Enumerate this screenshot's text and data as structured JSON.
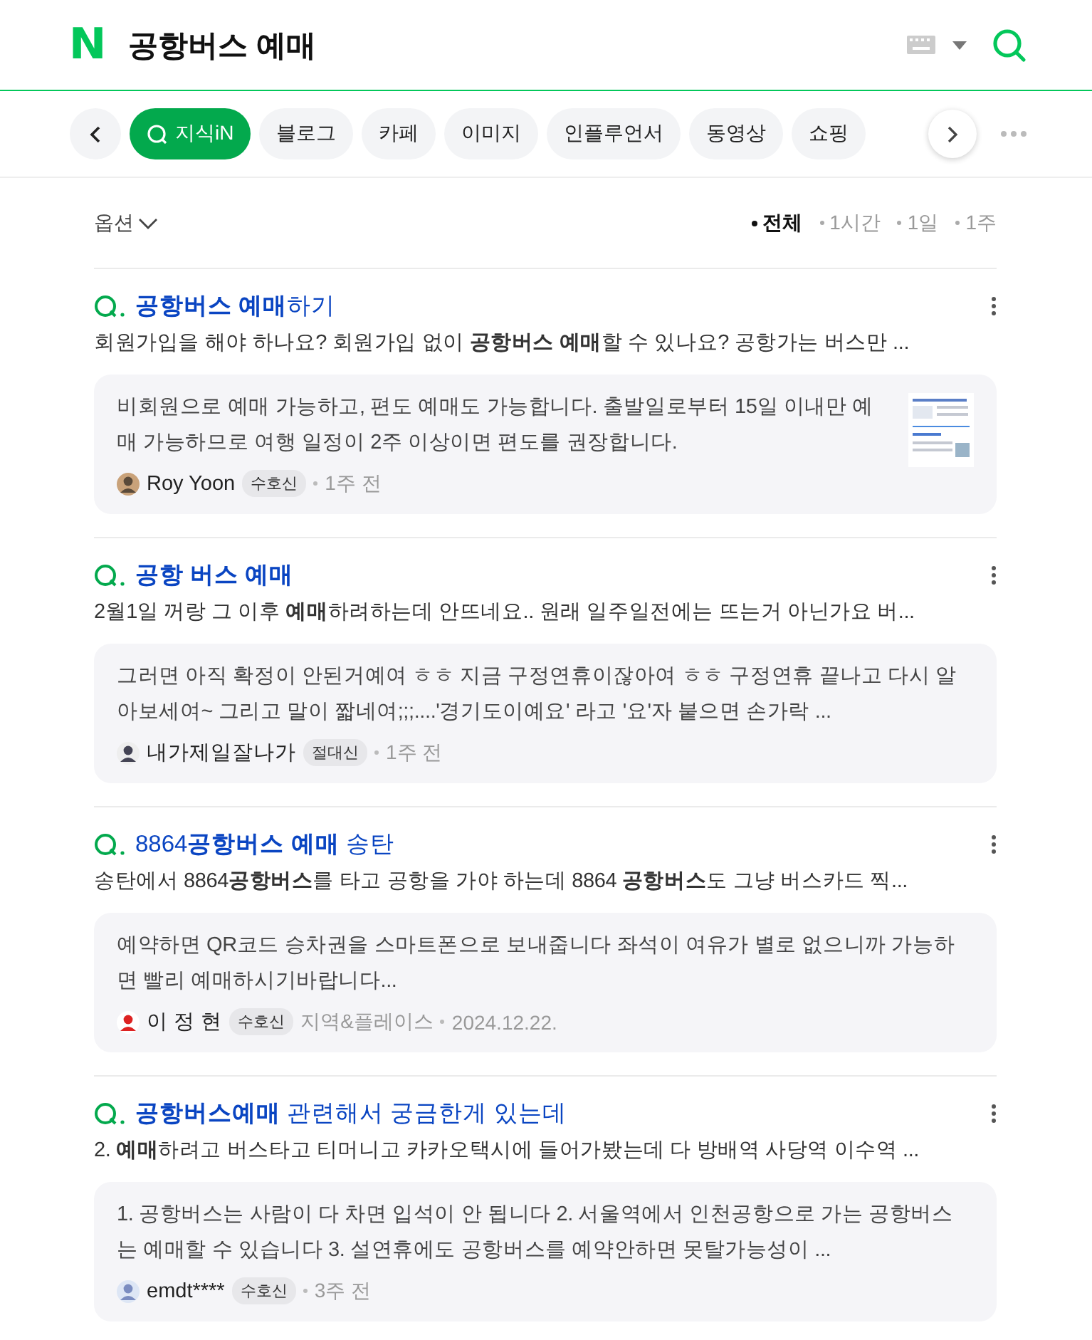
{
  "header": {
    "logo": "N",
    "query": "공항버스 예매"
  },
  "tabs": [
    {
      "label": "지식iN",
      "selected": true
    },
    {
      "label": "블로그",
      "selected": false
    },
    {
      "label": "카페",
      "selected": false
    },
    {
      "label": "이미지",
      "selected": false
    },
    {
      "label": "인플루언서",
      "selected": false
    },
    {
      "label": "동영상",
      "selected": false
    },
    {
      "label": "쇼핑",
      "selected": false
    }
  ],
  "options": {
    "label": "옵션",
    "periods": [
      {
        "label": "전체",
        "selected": true
      },
      {
        "label": "1시간",
        "selected": false
      },
      {
        "label": "1일",
        "selected": false
      },
      {
        "label": "1주",
        "selected": false
      }
    ]
  },
  "results": [
    {
      "title": "**공항버스 예매**하기",
      "snippet": "회원가입을 해야 하나요? 회원가입 없이 **공항버스 예매**할 수 있나요? 공항가는 버스만 ...",
      "answer": "비회원으로 예매 가능하고, 편도 예매도 가능합니다. 출발일로부터 15일 이내만 예매 가능하므로 여행 일정이 2주 이상이면 편도를 권장합니다.",
      "thumbnail": true,
      "author": "Roy Yoon",
      "badge": "수호신",
      "time": "1주 전"
    },
    {
      "title": "**공항 버스 예매**",
      "snippet": "2월1일 꺼랑 그 이후 **예매**하려하는데 안뜨네요.. 원래 일주일전에는 뜨는거 아닌가요 버...",
      "answer": "그러면 아직 확정이 안된거예여 ㅎㅎ 지금 구정연휴이잖아여 ㅎㅎ 구정연휴 끝나고 다시 알아보세여~ 그리고 말이 짧네여;;;....'경기도이예요' 라고 '요'자 붙으면 손가락 ...",
      "thumbnail": false,
      "author": "내가제일잘나가",
      "badge": "절대신",
      "time": "1주 전"
    },
    {
      "title": "8864**공항버스 예매** 송탄",
      "snippet": "송탄에서 8864**공항버스**를 타고 공항을 가야 하는데 8864 **공항버스**도 그냥 버스카드 찍...",
      "answer": "예약하면 QR코드 승차권을 스마트폰으로 보내줍니다 좌석이 여유가 별로 없으니까 가능하면 빨리 예매하시기바랍니다...",
      "thumbnail": false,
      "author": "이 정 현",
      "badge": "수호신",
      "source": "지역&플레이스",
      "time": "2024.12.22."
    },
    {
      "title": "**공항버스예매** 관련해서 궁금한게 있는데",
      "snippet": "2. **예매**하려고 버스타고 티머니고 카카오택시에 들어가봤는데 다 방배역 사당역 이수역 ...",
      "answer": "1. 공항버스는 사람이 다 차면 입석이 안 됩니다 2. 서울역에서 인천공항으로 가는 공항버스는 예매할 수 있습니다 3. 설연휴에도 공항버스를 예약안하면 못탈가능성이 ...",
      "thumbnail": false,
      "author": "emdt****",
      "badge": "수호신",
      "time": "3주 전"
    }
  ]
}
